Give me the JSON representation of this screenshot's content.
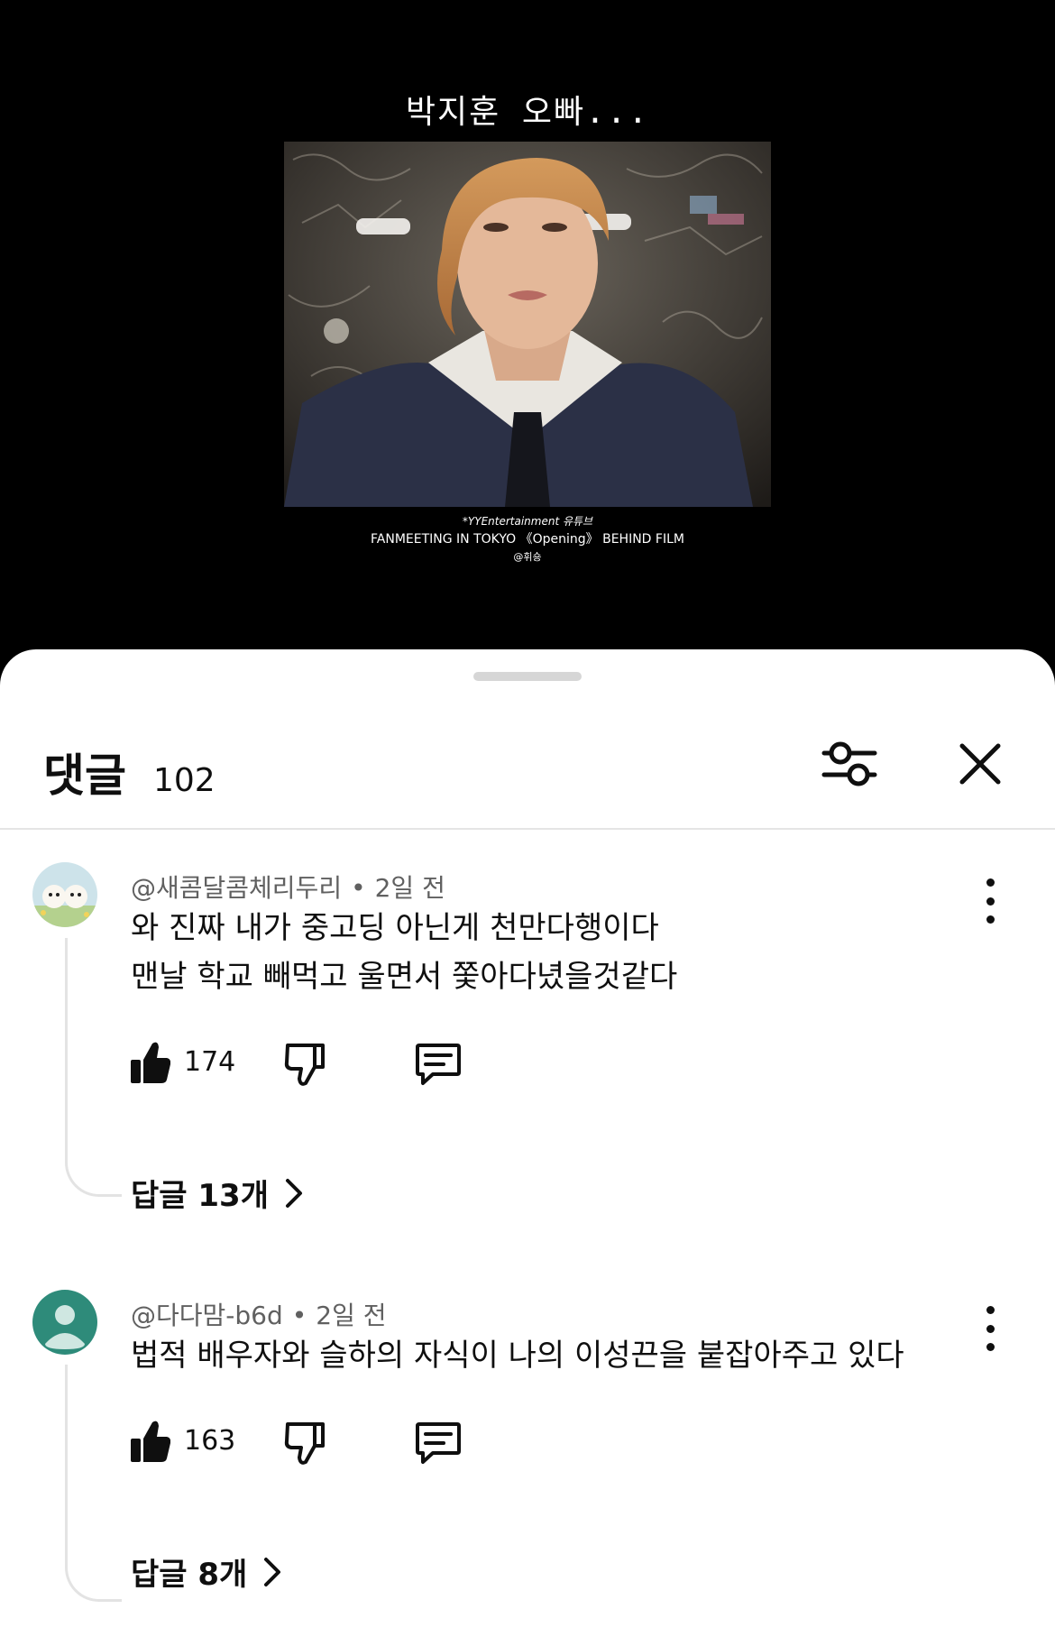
{
  "video": {
    "title": "박지훈 오빠...",
    "credit_source": "*YYEntertainment 유튜브",
    "credit_film": "FANMEETING IN TOKYO 《Opening》 BEHIND FILM",
    "credit_author": "@휘숑"
  },
  "comments_panel": {
    "title": "댓글",
    "count": "102",
    "filter_icon": "sliders-icon",
    "close_icon": "close-icon"
  },
  "comments": [
    {
      "author": "@새콤달콤체리두리",
      "time": "2일 전",
      "text_line1": "와 진짜 내가 중고딩 아닌게 천만다행이다",
      "text_line2": "맨날 학교 빼먹고 울면서 쫓아다녔을것같다",
      "likes": "174",
      "replies_label": "답글 13개"
    },
    {
      "author": "@다다맘-b6d",
      "time": "2일 전",
      "text_line1": "법적 배우자와 슬하의 자식이 나의 이성끈을 붙잡아주고 있다",
      "likes": "163",
      "replies_label": "답글 8개"
    }
  ]
}
